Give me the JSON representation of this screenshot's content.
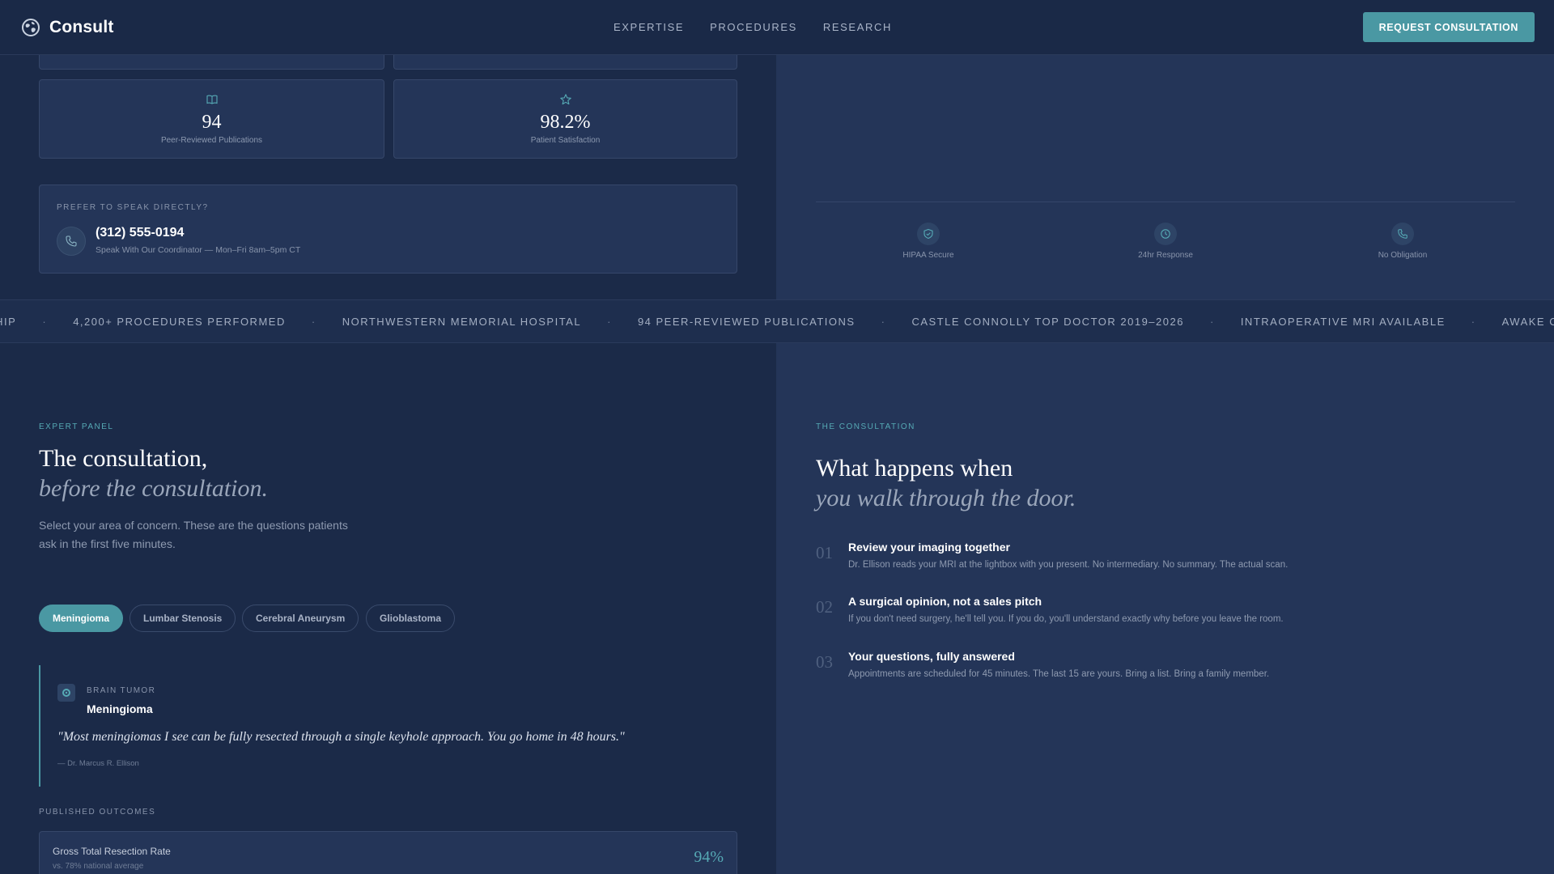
{
  "nav": {
    "brand": "Consult",
    "links": [
      "EXPERTISE",
      "PROCEDURES",
      "RESEARCH"
    ],
    "cta": "REQUEST CONSULTATION"
  },
  "stats": [
    {
      "icon": "book-open-icon",
      "value": "94",
      "label": "Peer-Reviewed Publications"
    },
    {
      "icon": "star-icon",
      "value": "98.2%",
      "label": "Patient Satisfaction"
    }
  ],
  "contact": {
    "eyebrow": "PREFER TO SPEAK DIRECTLY?",
    "phone": "(312) 555-0194",
    "sub": "Speak With Our Coordinator — Mon–Fri 8am–5pm CT"
  },
  "trust": [
    {
      "icon": "shield-check-icon",
      "label": "HIPAA Secure"
    },
    {
      "icon": "clock-icon",
      "label": "24hr Response"
    },
    {
      "icon": "phone-icon",
      "label": "No Obligation"
    }
  ],
  "ticker": [
    "SHIP",
    "4,200+ PROCEDURES PERFORMED",
    "NORTHWESTERN MEMORIAL HOSPITAL",
    "94 PEER-REVIEWED PUBLICATIONS",
    "CASTLE CONNOLLY TOP DOCTOR 2019–2026",
    "INTRAOPERATIVE MRI AVAILABLE",
    "AWAKE CRANIOTOMY SPECI"
  ],
  "expert": {
    "eyebrow": "EXPERT PANEL",
    "title": "The consultation,",
    "title_italic": "before the consultation.",
    "lead_line1": "Select your area of concern. These are the questions patients",
    "lead_line2": "ask in the first five minutes.",
    "tabs": [
      "Meningioma",
      "Lumbar Stenosis",
      "Cerebral Aneurysm",
      "Glioblastoma"
    ],
    "active_tab": "Meningioma",
    "quote": {
      "category": "BRAIN TUMOR",
      "name": "Meningioma",
      "text": "\"Most meningiomas I see can be fully resected through a single keyhole approach. You go home in 48 hours.\"",
      "author": "— Dr. Marcus R. Ellison"
    },
    "outcomes_label": "PUBLISHED OUTCOMES",
    "outcome": {
      "title": "Gross Total Resection Rate",
      "sub": "vs. 78% national average",
      "value": "94%"
    }
  },
  "consultation": {
    "eyebrow": "THE CONSULTATION",
    "title": "What happens when",
    "title_italic": "you walk through the door.",
    "steps": [
      {
        "num": "01",
        "title": "Review your imaging together",
        "desc": "Dr. Ellison reads your MRI at the lightbox with you present. No intermediary. No summary. The actual scan."
      },
      {
        "num": "02",
        "title": "A surgical opinion, not a sales pitch",
        "desc": "If you don't need surgery, he'll tell you. If you do, you'll understand exactly why before you leave the room."
      },
      {
        "num": "03",
        "title": "Your questions, fully answered",
        "desc": "Appointments are scheduled for 45 minutes. The last 15 are yours. Bring a list. Bring a family member."
      }
    ]
  },
  "colors": {
    "accent": "#4a98a3",
    "background": "#1b2a48",
    "panel": "#243558"
  }
}
